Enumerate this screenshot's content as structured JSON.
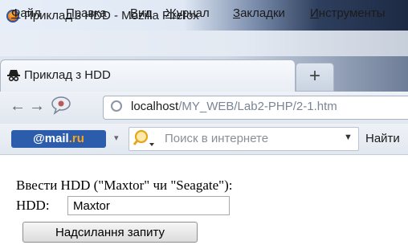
{
  "window": {
    "title": "Приклад з HDD - Mozilla Firefox"
  },
  "menu": {
    "items": [
      "Файл",
      "Правка",
      "Вид",
      "Журнал",
      "Закладки",
      "Инструменты"
    ],
    "underlined_first_letters": [
      "Ф",
      "П",
      "В",
      "Ж",
      "З",
      "И"
    ],
    "rest": [
      "айл",
      "равка",
      "ид",
      "урнал",
      "акладки",
      "нструменты"
    ]
  },
  "tabs": {
    "active_label": "Приклад з HDD",
    "new_tab_symbol": "+"
  },
  "navigation": {
    "back_symbol": "←",
    "forward_symbol": "→",
    "url_host": "localhost",
    "url_path": "/MY_WEB/Lab2-PHP/2-1.htm"
  },
  "toolbar": {
    "mail_prefix": "@mail",
    "mail_suffix": ".ru",
    "search_placeholder": "Поиск в интернете",
    "find_label": "Найти"
  },
  "page": {
    "prompt_text": "Ввести HDD (\"Maxtor\" чи \"Seagate\"):",
    "hdd_label": "HDD:",
    "hdd_value": "Maxtor",
    "submit_label": "Надсилання запиту"
  },
  "colors": {
    "mail_logo_bg": "#2b5dac",
    "mail_ru_accent": "#ffa414"
  },
  "icons": {
    "window": "firefox-icon",
    "tab": "spy-hat-icon",
    "history": "speech-bubble-icon",
    "url": "globe-icon",
    "search": "magnifier-icon"
  }
}
